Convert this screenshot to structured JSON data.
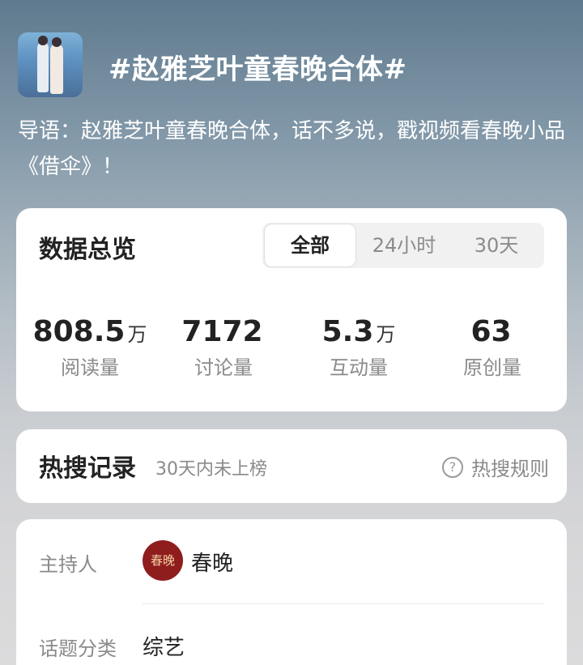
{
  "topic": {
    "title": "#赵雅芝叶童春晚合体#",
    "intro": "导语：赵雅芝叶童春晚合体，话不多说，戳视频看春晚小品《借伞》！"
  },
  "overview": {
    "title": "数据总览",
    "tabs": [
      {
        "label": "全部",
        "active": true
      },
      {
        "label": "24小时",
        "active": false
      },
      {
        "label": "30天",
        "active": false
      }
    ],
    "metrics": [
      {
        "value": "808.5",
        "unit": "万",
        "label": "阅读量"
      },
      {
        "value": "7172",
        "unit": "",
        "label": "讨论量"
      },
      {
        "value": "5.3",
        "unit": "万",
        "label": "互动量"
      },
      {
        "value": "63",
        "unit": "",
        "label": "原创量"
      }
    ]
  },
  "hot_search": {
    "title": "热搜记录",
    "note": "30天内未上榜",
    "rule_icon": "question-circle-icon",
    "rule_label": "热搜规则"
  },
  "info": {
    "host_label": "主持人",
    "host_avatar_text": "春晚",
    "host_name": "春晚",
    "category_label": "话题分类",
    "category_value": "综艺"
  },
  "colors": {
    "host_avatar_bg": "#8f1d1d",
    "text_primary": "#222222",
    "text_secondary": "#8a8a8a"
  }
}
